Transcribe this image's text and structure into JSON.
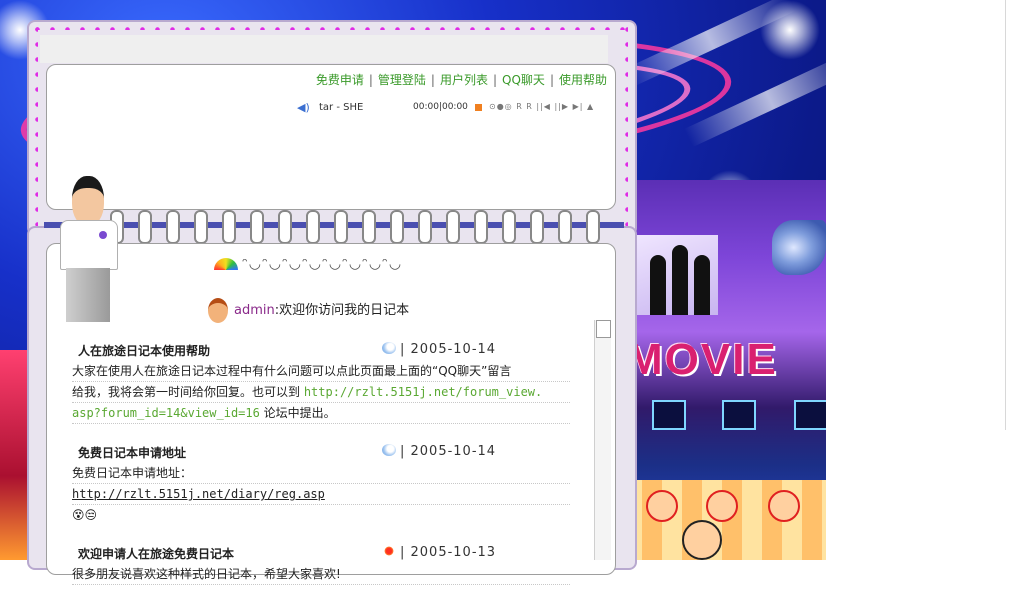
{
  "nav": {
    "items": [
      "免费申请",
      "管理登陆",
      "用户列表",
      "QQ聊天",
      "使用帮助"
    ],
    "separator": "|"
  },
  "player": {
    "track": "tar - SHE",
    "time": "00:00|00:00",
    "controls": "⊙●◎ R R ||◀ ||▶ ▶| ▲"
  },
  "greeting": {
    "user": "admin",
    "text": ":欢迎你访问我的日记本",
    "decor": "ᵔ◡ᵔ◡ᵔ◡ᵔ◡ᵔ◡ᵔ◡ᵔ◡ᵔ◡"
  },
  "posts": [
    {
      "title": "人在旅途日记本使用帮助",
      "weather_icon": "cloud-rain-icon",
      "date": "| 2005-10-14",
      "lines": [
        "大家在使用人在旅途日记本过程中有什么问题可以点此页面最上面的“QQ聊天”留言",
        "给我，我将会第一时间给你回复。也可以到 "
      ],
      "link_part1": "http://rzlt.5151j.net/forum_view.",
      "link_part2": "asp?forum_id=14&view_id=16",
      "after_link": " 论坛中提出。"
    },
    {
      "title": "免费日记本申请地址",
      "weather_icon": "cloud-rain-icon",
      "date": "| 2005-10-14",
      "lines": [
        "免费日记本申请地址："
      ],
      "link": "http://rzlt.5151j.net/diary/reg.asp",
      "emoji": "😵😒"
    },
    {
      "title": "欢迎申请人在旅途免费日记本",
      "weather_icon": "sun-icon",
      "date": "| 2005-10-13",
      "lines": [
        "很多朋友说喜欢这种样式的日记本，希望大家喜欢!"
      ]
    }
  ],
  "scene": {
    "sign_text": "MOVIE"
  }
}
